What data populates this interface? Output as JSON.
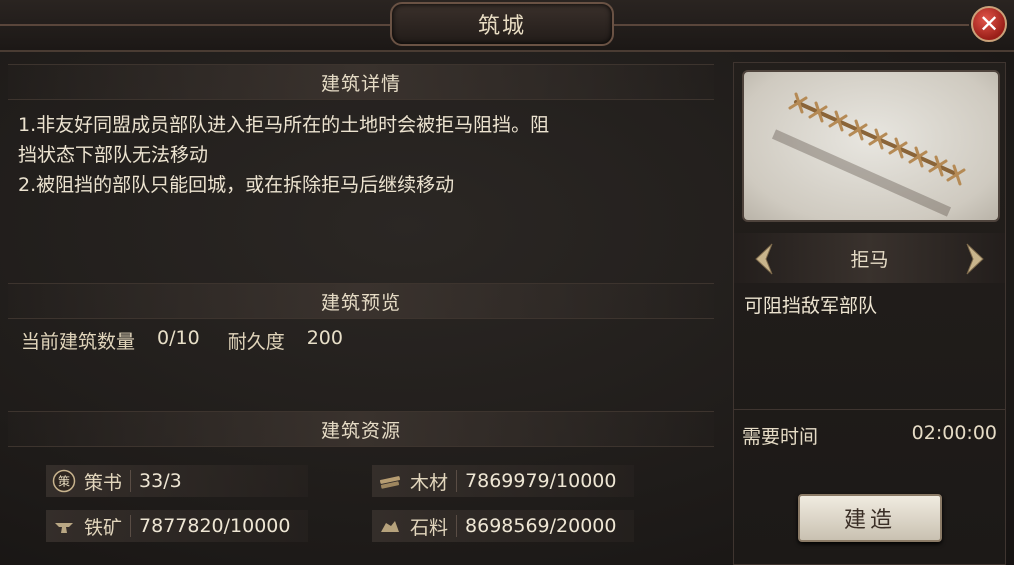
{
  "window": {
    "title": "筑城"
  },
  "close": {
    "label": "✕"
  },
  "sections": {
    "details": "建筑详情",
    "preview": "建筑预览",
    "resources": "建筑资源"
  },
  "description": {
    "line1": "1.非友好同盟成员部队进入拒马所在的土地时会被拒马阻挡。阻",
    "line2": "挡状态下部队无法移动",
    "line3": "2.被阻挡的部队只能回城，或在拆除拒马后继续移动"
  },
  "stats": {
    "count_label": "当前建筑数量",
    "count_value": "0/10",
    "durability_label": "耐久度",
    "durability_value": "200"
  },
  "resources": [
    {
      "icon": "strategy-book-icon",
      "label": "策书",
      "value": "33/3"
    },
    {
      "icon": "wood-icon",
      "label": "木材",
      "value": "7869979/10000"
    },
    {
      "icon": "iron-ore-icon",
      "label": "铁矿",
      "value": "7877820/10000"
    },
    {
      "icon": "stone-icon",
      "label": "石料",
      "value": "8698569/20000"
    }
  ],
  "building": {
    "name": "拒马",
    "description": "可阻挡敌军部队",
    "time_label": "需要时间",
    "time_value": "02:00:00",
    "build_label": "建造"
  },
  "icons": {
    "strategy_glyph": "策"
  }
}
